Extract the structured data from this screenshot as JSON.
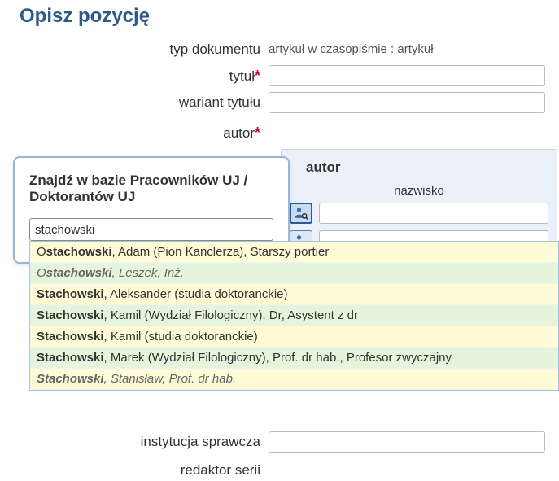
{
  "page_title": "Opisz pozycję",
  "labels": {
    "doc_type": "typ dokumentu",
    "title": "tytuł",
    "title_variant": "wariant tytułu",
    "author": "autor",
    "institution": "instytucja sprawcza",
    "series_editor": "redaktor serii"
  },
  "values": {
    "doc_type": "artykuł w czasopiśmie : artykuł"
  },
  "author_panel": {
    "heading": "autor",
    "subheading": "nazwisko"
  },
  "lookup": {
    "title": "Znajdź w bazie Pracowników UJ / Doktorantów UJ",
    "query": "stachowski"
  },
  "suggestions": [
    {
      "pre": "O",
      "bold": "stachowski",
      "post": ", Adam (Pion Kanclerza), Starszy portier",
      "inactive": false
    },
    {
      "pre": "O",
      "bold": "stachowski",
      "post": ", Leszek, Inż.",
      "inactive": true
    },
    {
      "pre": "",
      "bold": "Stachowski",
      "post": ", Aleksander (studia doktoranckie)",
      "inactive": false
    },
    {
      "pre": "",
      "bold": "Stachowski",
      "post": ", Kamil (Wydział Filologiczny), Dr, Asystent z dr",
      "inactive": false
    },
    {
      "pre": "",
      "bold": "Stachowski",
      "post": ", Kamil (studia doktoranckie)",
      "inactive": false
    },
    {
      "pre": "",
      "bold": "Stachowski",
      "post": ", Marek (Wydział Filologiczny), Prof. dr hab., Profesor zwyczajny",
      "inactive": false
    },
    {
      "pre": "",
      "bold": "Stachowski",
      "post": ", Stanisław, Prof. dr hab.",
      "inactive": true
    }
  ]
}
